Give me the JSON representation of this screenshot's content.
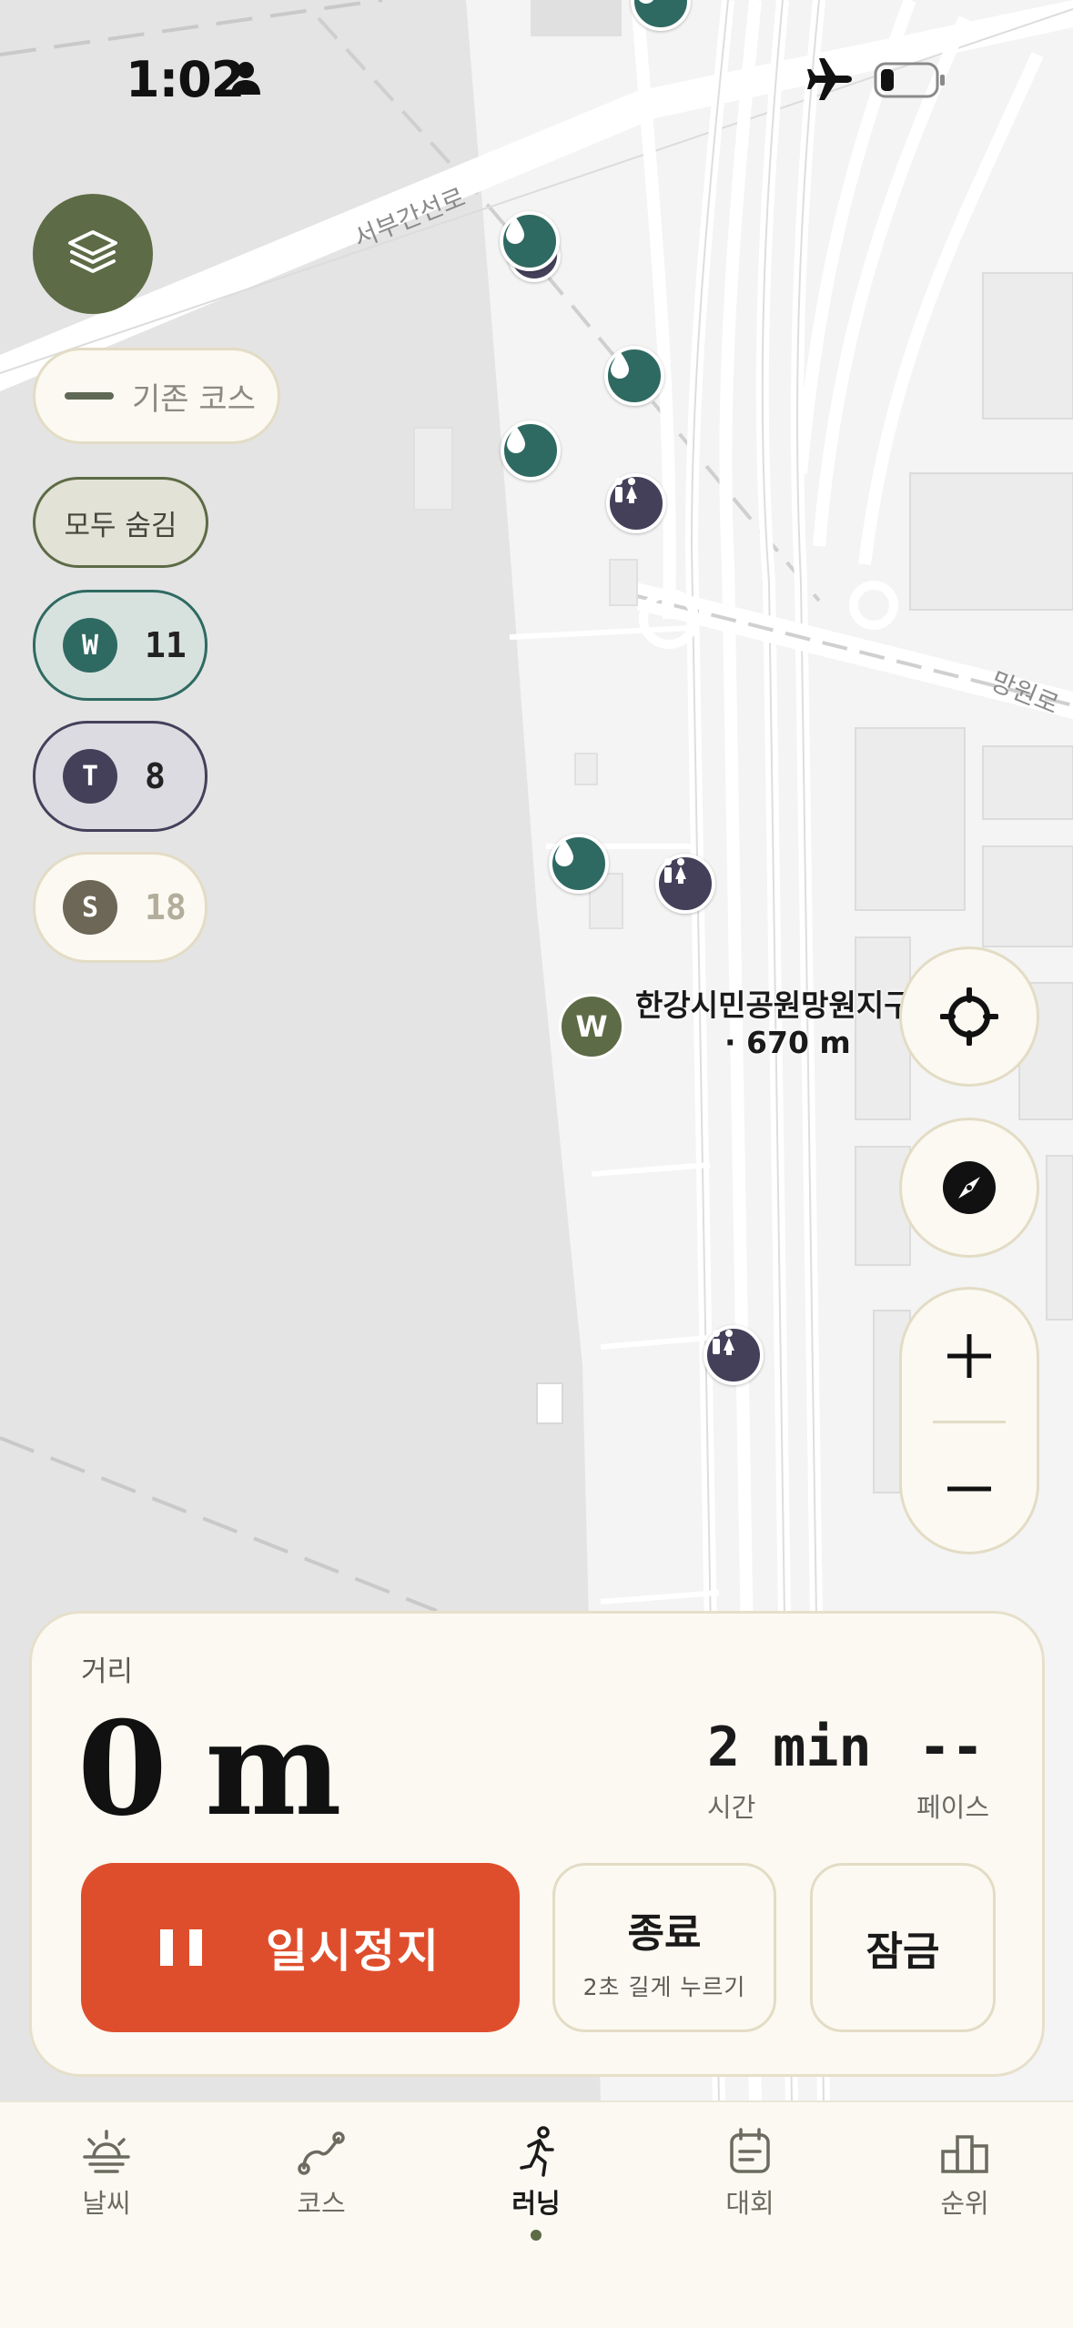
{
  "status_bar": {
    "time": "1:02",
    "icons": [
      "person-icon",
      "airplane-icon",
      "battery-icon"
    ]
  },
  "map": {
    "road_labels": [
      "서부간선로",
      "망원로"
    ],
    "place": {
      "badge": "W",
      "name": "한강시민공원망원지구",
      "distance": "· 670 m"
    },
    "marker_icons": [
      "water-drop-icon",
      "toilet-icon"
    ]
  },
  "controls": {
    "course_toggle": "기존 코스",
    "hide_all": "모두 숨김",
    "categories": [
      {
        "badge": "W",
        "count": "11",
        "color": "#2f6a62"
      },
      {
        "badge": "T",
        "count": "8",
        "color": "#45405a"
      },
      {
        "badge": "S",
        "count": "18",
        "color": "#6c6756"
      }
    ]
  },
  "run_panel": {
    "distance_label": "거리",
    "distance_value": "0 m",
    "time_value": "2 min",
    "time_label": "시간",
    "pace_value": "--",
    "pace_label": "페이스",
    "pause_label": "일시정지",
    "end_label": "종료",
    "end_hint": "2초 길게 누르기",
    "lock_label": "잠금"
  },
  "tabs": [
    {
      "label": "날씨",
      "icon": "weather-icon"
    },
    {
      "label": "코스",
      "icon": "course-icon"
    },
    {
      "label": "러닝",
      "icon": "running-icon",
      "active": true
    },
    {
      "label": "대회",
      "icon": "calendar-icon"
    },
    {
      "label": "순위",
      "icon": "ranking-icon"
    }
  ],
  "colors": {
    "accent_olive": "#5d6b46",
    "water_green": "#2f6a62",
    "toilet_purple": "#45405a",
    "pause_orange": "#df4e2c",
    "panel_bg": "#fbf9f1"
  }
}
